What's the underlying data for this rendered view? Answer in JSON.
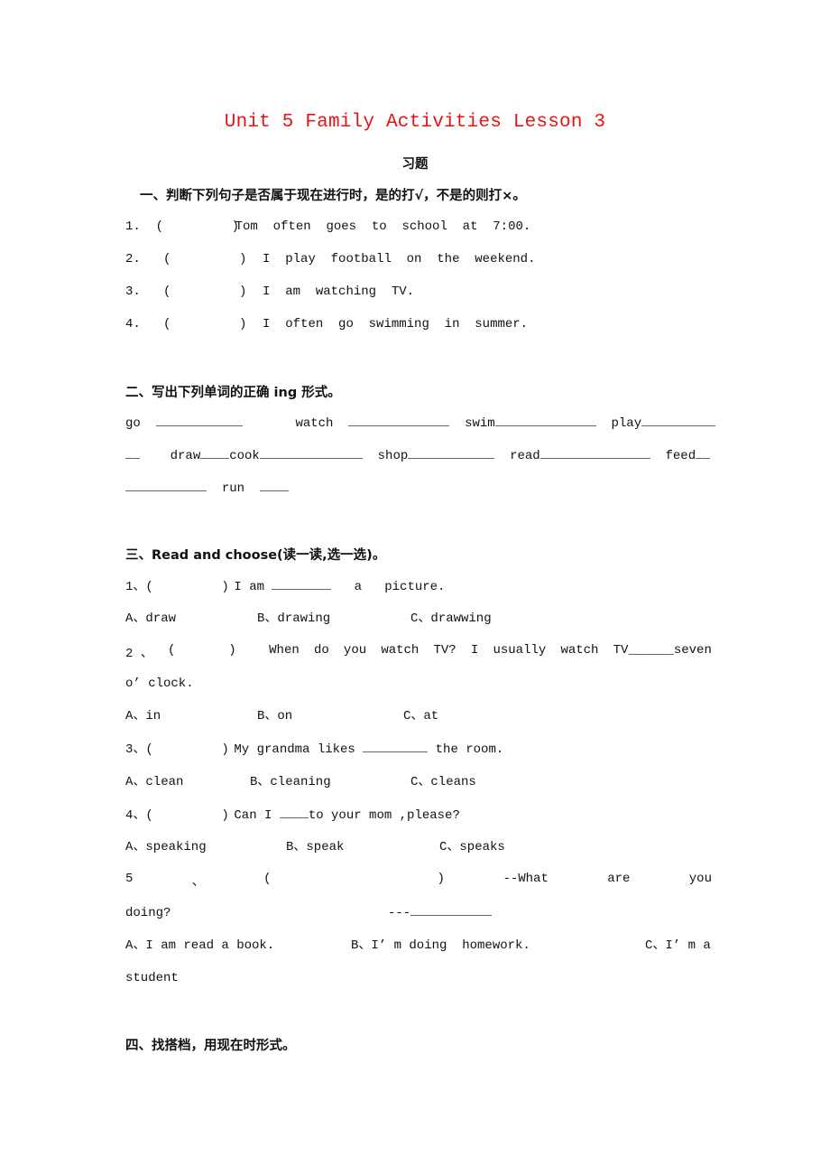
{
  "title": "Unit 5 Family Activities Lesson 3",
  "subtitle": "习题",
  "section1": {
    "heading": "一、判断下列句子是否属于现在进行时，是的打√，不是的则打×。",
    "items": [
      {
        "num": "1.",
        "paren": "(        )",
        "text": "Tom  often  goes  to  school  at  7:00."
      },
      {
        "num": "2.",
        "paren": "(        )",
        "text": "I  play  football  on  the  weekend."
      },
      {
        "num": "3.",
        "paren": "(        )",
        "text": "I  am  watching  TV."
      },
      {
        "num": "4.",
        "paren": "(        )",
        "text": "I  often  go  swimming  in  summer."
      }
    ]
  },
  "section2": {
    "heading": "二、写出下列单词的正确 ing 形式。",
    "words": [
      "go",
      "watch",
      "swim",
      "play",
      "draw",
      "cook",
      "shop",
      "read",
      "feed",
      "run"
    ]
  },
  "section3": {
    "heading": "三、Read and choose(读一读,选一选)。",
    "q1": {
      "num": "1、",
      "paren": "(        )",
      "pre": "I am",
      "post": "a   picture.",
      "options": [
        "A、draw",
        "B、drawing",
        "C、drawwing"
      ]
    },
    "q2": {
      "num": "2 、",
      "paren": "(        )",
      "words": [
        "When",
        "do",
        "you",
        "watch",
        "TV?",
        "I",
        "usually",
        "watch",
        "TV______seven"
      ],
      "line2": "o’ clock.",
      "options": [
        "A、in",
        "B、on",
        "C、at"
      ]
    },
    "q3": {
      "num": "3、",
      "paren": "(        )",
      "pre": "My grandma likes",
      "post": "the room.",
      "options": [
        "A、clean",
        "B、cleaning",
        "C、cleans"
      ]
    },
    "q4": {
      "num": "4、",
      "paren": "(        )",
      "pre": "Can I",
      "post": "to your mom ,please?",
      "options": [
        "A、speaking",
        "B、speak",
        "C、speaks"
      ]
    },
    "q5": {
      "words": [
        "5",
        "、",
        "(",
        ")",
        "--What",
        "are",
        "you"
      ],
      "line2_pre": "doing?",
      "line2_dash": "---",
      "options": [
        "A、I am read a book.",
        "B、I’ m doing  homework.",
        "C、I’ m a"
      ],
      "option_cont": "student"
    }
  },
  "section4": {
    "heading": "四、找搭档，用现在时形式。"
  }
}
